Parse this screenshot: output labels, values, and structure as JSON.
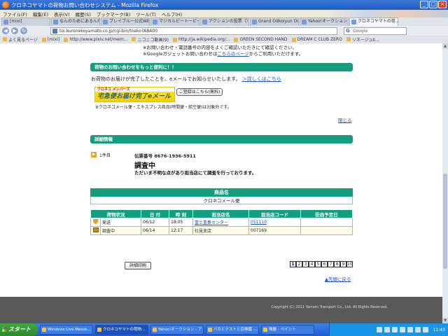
{
  "window": {
    "title": "クロネコヤマトの荷物お問い合わせシステム - Mozilla Firefox"
  },
  "menu": [
    "ファイル(F)",
    "編集(E)",
    "表示(V)",
    "履歴(S)",
    "ブックマーク(B)",
    "ツール(T)",
    "ヘルプ(H)"
  ],
  "tabs": [
    {
      "label": "[mixi]"
    },
    {
      "label": "なんのためにあるんだ"
    },
    {
      "label": "プレイブルー公式WEB..."
    },
    {
      "label": "マジカルピートーピート"
    },
    {
      "label": "アクションの投票（）レ"
    },
    {
      "label": "Grand Odkoiyun Onl..."
    },
    {
      "label": "Yahoo!オークション"
    },
    {
      "label": "クロネコヤマトの荷..."
    }
  ],
  "nav": {
    "url": "toi.kuronekoyamato.co.jp/cgi-bin/tneko?ABA00",
    "search_placeholder": "Google"
  },
  "bookmarks": [
    "よく見るページ",
    "[mixi]",
    "http://www.pixiv.net/mem...",
    "ニコニコ動画(9)",
    "http://ja.wikipedia.org/...",
    "GREEN SECOND HAND",
    "DREAM C CLUB ZERO",
    "リネージュII..."
  ],
  "notes": {
    "line1_prefix": "※お問い合わせ・電話番号の内容をよくご確認いただき",
    "line1_suffix": "にて確認ください。",
    "line2_prefix": "※Googleガジェットお問い合わせは",
    "line2_link": "こちらのページ",
    "line2_suffix": "からご利用いただけます。"
  },
  "section1": {
    "header": "荷物のお問い合わせをもっと便利に！！",
    "text": "お荷物のお届けが完了したことを、eメールでお知らせいたします。",
    "link": "＞詳しくはこちら",
    "banner_top": "クロネコ メンバーズ",
    "banner_bottom": "宅急便お届け完了eメール",
    "register_button": "ご登録はこちら(無料)",
    "note": "※クロネコメール便・エキスプレス商品(時間便・航空便)は対象外です。",
    "close_link": "閉じる"
  },
  "section2": {
    "header": "詳細情報",
    "item_count": "1件目",
    "tracking_number": "伝票番号 8676-1936-5911",
    "status": "調査中",
    "status_desc": "ただいま不明な点があり担当店にて調査を行っております。"
  },
  "product_table": {
    "header": "商品名",
    "value": "クロネコメール便"
  },
  "detail_table": {
    "headers": [
      "荷物状況",
      "日 付",
      "時 刻",
      "担当店名",
      "担当店コード",
      "投函予定日"
    ],
    "rows": [
      {
        "status": "発送",
        "date": "06/12",
        "time": "18:05",
        "store": "富士重集センター",
        "code": "051110",
        "planned": ""
      },
      {
        "status": "調査中",
        "date": "06/14",
        "time": "12:17",
        "store": "社見支店",
        "code": "007169",
        "planned": ""
      }
    ]
  },
  "print_button": "詳細印刷",
  "pagination": [
    "1",
    "2",
    "3",
    "4",
    "5",
    "6",
    "7",
    "8",
    "9",
    "10"
  ],
  "top_link": "▲先頭に戻る",
  "copyright": "Copyright (C) 2011 Yamato Transport Co., Ltd. All Rights Reserved.",
  "taskbar": {
    "start": "スタート",
    "tasks": [
      "Windows Live Messe...",
      "クロネコヤマトの荷物...",
      "Yahoo!オークション - ア...",
      "バカとテストと召喚獣 -...",
      "無題 - ペイント"
    ],
    "clock": "11:43"
  },
  "colors": {
    "accent": "#139e7f",
    "link": "#2255bb"
  }
}
